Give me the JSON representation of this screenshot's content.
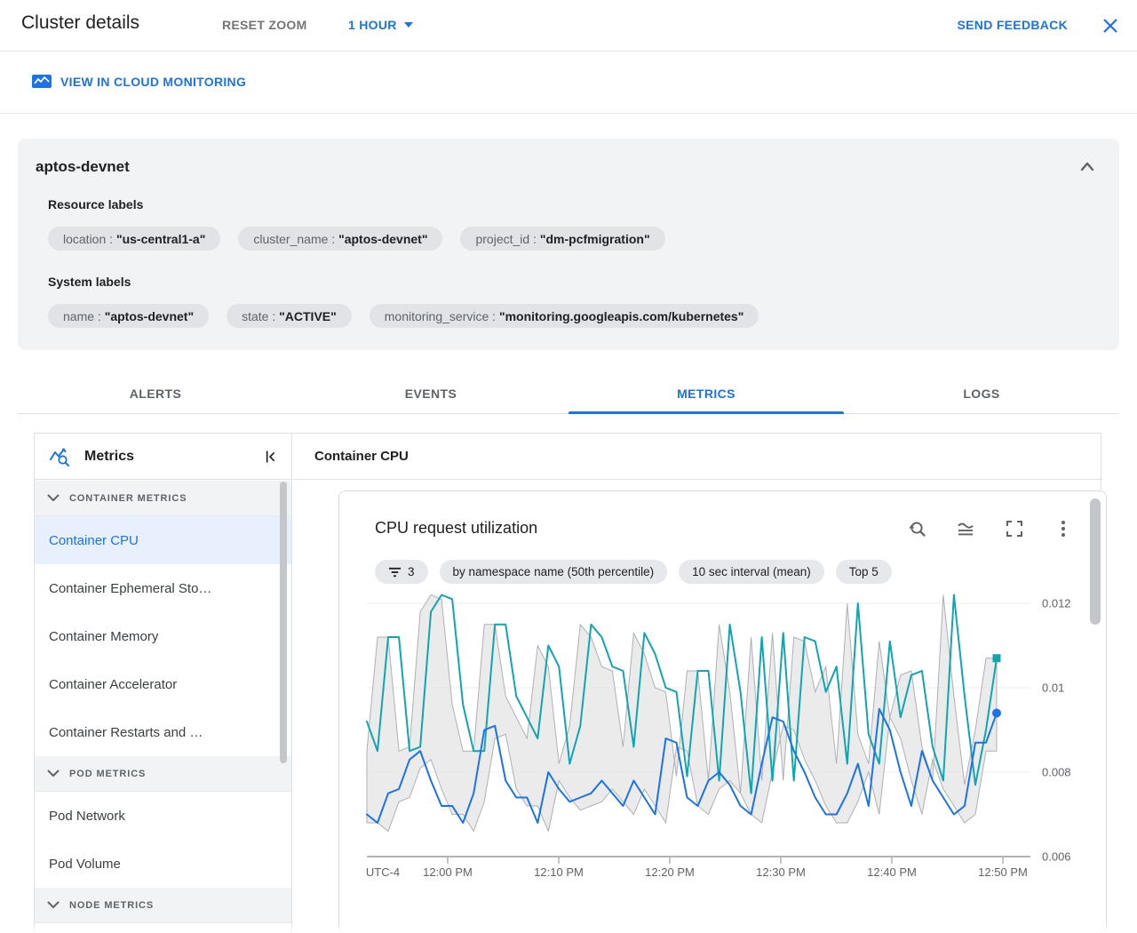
{
  "header": {
    "title": "Cluster details",
    "reset_zoom_label": "RESET ZOOM",
    "time_range_label": "1 HOUR",
    "send_feedback_label": "SEND FEEDBACK"
  },
  "monitoring_link": {
    "label": "VIEW IN CLOUD MONITORING"
  },
  "cluster_card": {
    "name": "aptos-devnet",
    "label_separator": " : ",
    "resource_labels_title": "Resource labels",
    "resource_labels": [
      {
        "key": "location",
        "value": "\"us-central1-a\""
      },
      {
        "key": "cluster_name",
        "value": "\"aptos-devnet\""
      },
      {
        "key": "project_id",
        "value": "\"dm-pcfmigration\""
      }
    ],
    "system_labels_title": "System labels",
    "system_labels": [
      {
        "key": "name",
        "value": "\"aptos-devnet\""
      },
      {
        "key": "state",
        "value": "\"ACTIVE\""
      },
      {
        "key": "monitoring_service",
        "value": "\"monitoring.googleapis.com/kubernetes\""
      }
    ]
  },
  "tabs": [
    {
      "label": "ALERTS"
    },
    {
      "label": "EVENTS"
    },
    {
      "label": "METRICS"
    },
    {
      "label": "LOGS"
    }
  ],
  "sidebar": {
    "title": "Metrics",
    "sections": [
      {
        "header": "CONTAINER METRICS",
        "items": [
          {
            "label": "Container CPU"
          },
          {
            "label": "Container Ephemeral Sto…"
          },
          {
            "label": "Container Memory"
          },
          {
            "label": "Container Accelerator"
          },
          {
            "label": "Container Restarts and …"
          }
        ]
      },
      {
        "header": "POD METRICS",
        "items": [
          {
            "label": "Pod Network"
          },
          {
            "label": "Pod Volume"
          }
        ]
      },
      {
        "header": "NODE METRICS",
        "items": []
      }
    ]
  },
  "main": {
    "panel_title": "Container CPU",
    "chart_card": {
      "title": "CPU request utilization",
      "chips": [
        {
          "label": "3",
          "icon": "filter-icon"
        },
        {
          "label": "by namespace name (50th percentile)"
        },
        {
          "label": "10 sec interval (mean)"
        },
        {
          "label": "Top 5"
        }
      ]
    }
  },
  "chart_data": {
    "type": "line",
    "title": "CPU request utilization",
    "x_axis": {
      "timezone_label": "UTC-4",
      "ticks": [
        "12:00 PM",
        "12:10 PM",
        "12:20 PM",
        "12:30 PM",
        "12:40 PM",
        "12:50 PM"
      ],
      "range_minutes": 60
    },
    "y_axis": {
      "ticks": [
        "0.006",
        "0.008",
        "0.01",
        "0.012"
      ],
      "range": [
        0.006,
        0.0125
      ],
      "grid": true
    },
    "legend_position": "none",
    "band": {
      "fill": "#e4e4e4",
      "stroke": "#9aa0a6"
    },
    "series": [
      {
        "name": "teal-series",
        "color": "#12a4af",
        "end_marker": "square",
        "values": [
          0.0092,
          0.0085,
          0.0112,
          0.0112,
          0.0085,
          0.0086,
          0.0118,
          0.0122,
          0.0121,
          0.0096,
          0.0085,
          0.0085,
          0.0115,
          0.0115,
          0.0098,
          0.0093,
          0.0088,
          0.011,
          0.0105,
          0.0082,
          0.0091,
          0.0115,
          0.0112,
          0.0105,
          0.0104,
          0.0086,
          0.0113,
          0.0108,
          0.01,
          0.0099,
          0.0079,
          0.0104,
          0.0104,
          0.0078,
          0.0115,
          0.0099,
          0.0075,
          0.0112,
          0.0078,
          0.0113,
          0.0078,
          0.0112,
          0.0111,
          0.0099,
          0.0105,
          0.0082,
          0.012,
          0.0089,
          0.0082,
          0.0111,
          0.0093,
          0.0103,
          0.0104,
          0.0086,
          0.0078,
          0.0122,
          0.0098,
          0.0077,
          0.009,
          0.0107
        ]
      },
      {
        "name": "blue-series",
        "color": "#1a73e8",
        "end_marker": "circle",
        "values": [
          0.007,
          0.0068,
          0.0075,
          0.0076,
          0.0083,
          0.0085,
          0.0078,
          0.0072,
          0.0072,
          0.0068,
          0.0075,
          0.009,
          0.0091,
          0.0078,
          0.0074,
          0.0074,
          0.0068,
          0.008,
          0.0076,
          0.0073,
          0.0074,
          0.0075,
          0.0078,
          0.0075,
          0.0072,
          0.0078,
          0.0074,
          0.007,
          0.0088,
          0.0087,
          0.0074,
          0.0072,
          0.0078,
          0.008,
          0.0077,
          0.0072,
          0.007,
          0.0082,
          0.0093,
          0.0092,
          0.0085,
          0.008,
          0.0074,
          0.007,
          0.007,
          0.0075,
          0.0082,
          0.0072,
          0.0095,
          0.009,
          0.008,
          0.0072,
          0.0085,
          0.0078,
          0.0074,
          0.007,
          0.0072,
          0.0087,
          0.0087,
          0.0094
        ]
      }
    ]
  }
}
